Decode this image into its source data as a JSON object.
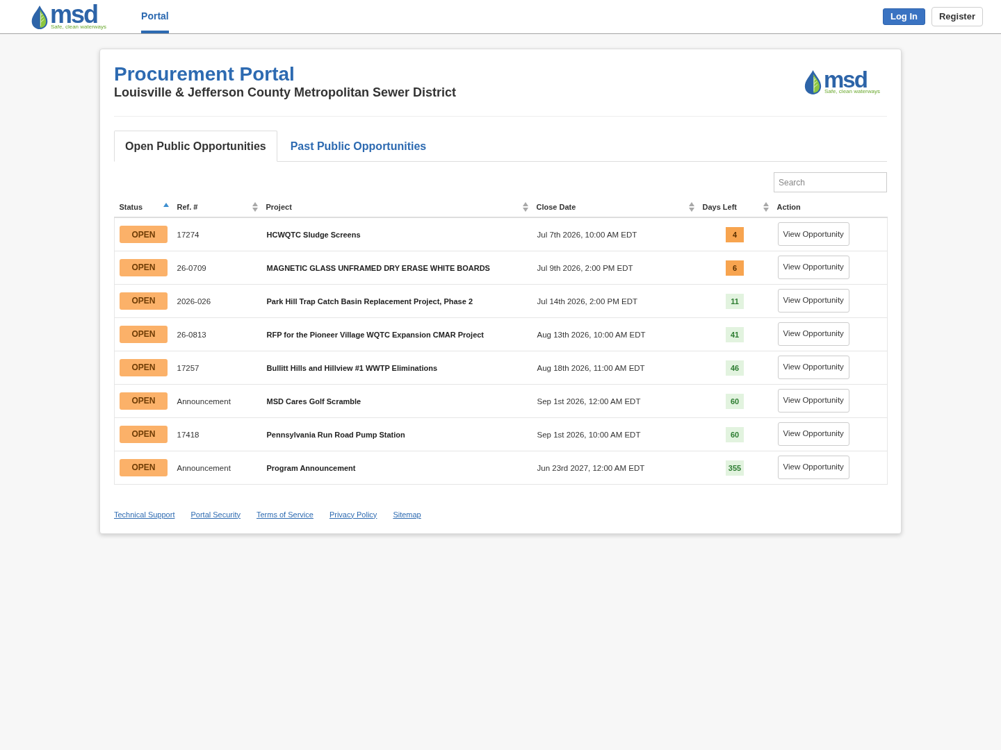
{
  "header": {
    "logo": {
      "wordmark": "msd",
      "tagline": "Safe, clean waterways"
    },
    "nav": [
      {
        "label": "Portal",
        "selected": true
      }
    ],
    "buttons": [
      {
        "label": "Log In",
        "kind": "primary"
      },
      {
        "label": "Register",
        "kind": "secondary"
      }
    ]
  },
  "card": {
    "title": "Procurement Portal",
    "subtitle": "Louisville & Jefferson County Metropolitan Sewer District",
    "logo": {
      "wordmark": "msd",
      "tagline": "Safe, clean waterways"
    },
    "tabs": [
      {
        "label": "Open Public Opportunities",
        "selected": true
      },
      {
        "label": "Past Public Opportunities",
        "selected": false
      }
    ],
    "search": {
      "placeholder": "Search"
    },
    "table": {
      "columns": [
        {
          "label": "Status",
          "sortable": true,
          "selected": true
        },
        {
          "label": "Ref. #",
          "sortable": true,
          "selected": false
        },
        {
          "label": "Project",
          "sortable": true,
          "selected": false
        },
        {
          "label": "Close Date",
          "sortable": true,
          "selected": false
        },
        {
          "label": "Days Left",
          "sortable": true,
          "selected": false
        },
        {
          "label": "Action",
          "sortable": false,
          "selected": false
        }
      ],
      "rows": [
        {
          "status": "OPEN",
          "ref": "17274",
          "project": "HCWQTC Sludge Screens",
          "close_date": "Jul 7th 2026, 10:00 AM EDT",
          "days_left": "4",
          "urgent": true,
          "action": "View Opportunity"
        },
        {
          "status": "OPEN",
          "ref": "26-0709",
          "project": "MAGNETIC GLASS UNFRAMED DRY ERASE WHITE BOARDS",
          "close_date": "Jul 9th 2026, 2:00 PM EDT",
          "days_left": "6",
          "urgent": true,
          "action": "View Opportunity"
        },
        {
          "status": "OPEN",
          "ref": "2026-026",
          "project": "Park Hill Trap Catch Basin Replacement Project, Phase 2",
          "close_date": "Jul 14th 2026, 2:00 PM EDT",
          "days_left": "11",
          "urgent": false,
          "action": "View Opportunity"
        },
        {
          "status": "OPEN",
          "ref": "26-0813",
          "project": "RFP for the Pioneer Village WQTC Expansion CMAR Project",
          "close_date": "Aug 13th 2026, 10:00 AM EDT",
          "days_left": "41",
          "urgent": false,
          "action": "View Opportunity"
        },
        {
          "status": "OPEN",
          "ref": "17257",
          "project": "Bullitt Hills and Hillview #1 WWTP Eliminations",
          "close_date": "Aug 18th 2026, 11:00 AM EDT",
          "days_left": "46",
          "urgent": false,
          "action": "View Opportunity"
        },
        {
          "status": "OPEN",
          "ref": "Announcement",
          "project": "MSD Cares Golf Scramble",
          "close_date": "Sep 1st 2026, 12:00 AM EDT",
          "days_left": "60",
          "urgent": false,
          "action": "View Opportunity"
        },
        {
          "status": "OPEN",
          "ref": "17418",
          "project": "Pennsylvania Run Road Pump Station",
          "close_date": "Sep 1st 2026, 10:00 AM EDT",
          "days_left": "60",
          "urgent": false,
          "action": "View Opportunity"
        },
        {
          "status": "OPEN",
          "ref": "Announcement",
          "project": "Program Announcement",
          "close_date": "Jun 23rd 2027, 12:00 AM EDT",
          "days_left": "355",
          "urgent": false,
          "action": "View Opportunity"
        }
      ]
    },
    "footer_links": [
      "Technical Support",
      "Portal Security",
      "Terms of Service",
      "Privacy Policy",
      "Sitemap"
    ]
  }
}
